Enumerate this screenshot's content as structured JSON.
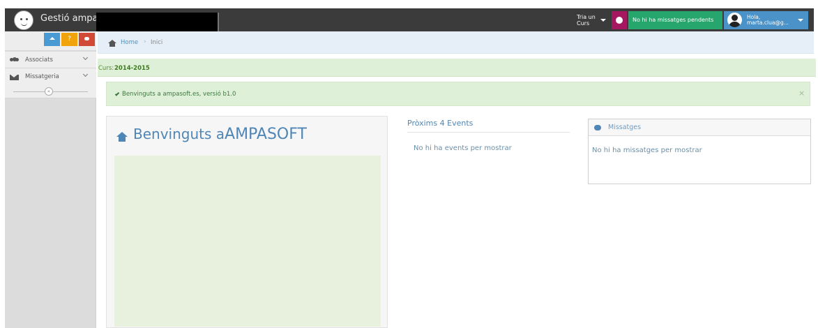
{
  "header": {
    "brand": "Gestió ampa",
    "tria_line1": "Tria un",
    "tria_line2": "Curs",
    "messages_status": "No hi ha missatges pendents",
    "user_greeting": "Hola,",
    "user_email": "marta.clua@g..."
  },
  "sidebar": {
    "shortcuts": [
      {
        "label": ""
      },
      {
        "label": "?"
      },
      {
        "label": ""
      }
    ],
    "items": [
      {
        "label": "Associats"
      },
      {
        "label": "Missatgeria"
      }
    ],
    "collapse_glyph": "«"
  },
  "breadcrumb": {
    "home": "Home",
    "separator": "›",
    "current": "Inici"
  },
  "curs": {
    "label": "Curs:",
    "value": "2014-2015"
  },
  "alert": {
    "text": "Benvinguts a ampasoft.es, versió b1.0",
    "close": "×"
  },
  "welcome": {
    "title_part1": "Benvinguts a",
    "title_part2": "AMPASOFT"
  },
  "events": {
    "title": "Pròxims 4 Events",
    "empty": "No hi ha events per mostrar"
  },
  "messages_panel": {
    "title": "Missatges",
    "empty": "No hi ha missatges per mostrar"
  },
  "colors": {
    "navbar": "#3b3b3b",
    "brand_blue": "#4f86b5",
    "success_green": "#26a56c",
    "alert_bg": "#dff0d8",
    "user_blue": "#4a92c7",
    "globe_magenta": "#a5185f"
  }
}
